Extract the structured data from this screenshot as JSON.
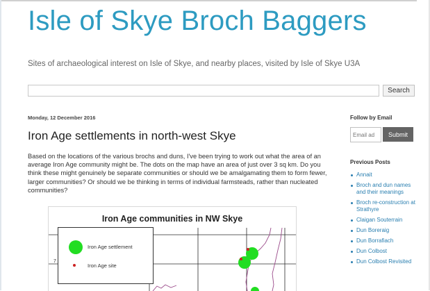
{
  "blog": {
    "title": "Isle of Skye Broch Baggers",
    "description": "Sites of archaeological interest on Isle of Skye, and nearby places, visited by Isle of Skye U3A"
  },
  "search": {
    "value": "",
    "button_label": "Search"
  },
  "post": {
    "date": "Monday, 12 December 2016",
    "title": "Iron Age settlements in north-west Skye",
    "body": "Based on the locations of the various brochs and duns,  I've been trying to work out what the area of an average Iron Age community might be. The dots on the map have an area of just over 3 sq km. Do you think these might genuinely be separate communities or should we be amalgamating them to form fewer, larger communities? Or should we be thinking in terms of individual farmsteads, rather than nucleated communities?",
    "figure": {
      "title": "Iron Age communities in NW Skye",
      "axis_tick": "7",
      "legend": {
        "settlement_label": "Iron Age settlement",
        "site_label": "Iron Age site"
      },
      "colors": {
        "settlement": "#22dd22",
        "site": "#cc2222",
        "grid": "#2a2a2a",
        "coast": "#9a4a8a"
      }
    }
  },
  "sidebar": {
    "follow_heading": "Follow by Email",
    "email_placeholder": "Email ad",
    "submit_label": "Submit",
    "previous_heading": "Previous Posts",
    "previous_posts": [
      "Annait",
      "Broch and dun names and their meanings",
      "Broch re-construction at Strathyre",
      "Claigan Souterrain",
      "Dun Boreraig",
      "Dun Borrafiach",
      "Dun Colbost",
      "Dun Colbost Revisited"
    ]
  },
  "colors": {
    "title_blue": "#2d9bc1",
    "link_blue": "#2a7fb0",
    "submit_bg": "#646464"
  }
}
